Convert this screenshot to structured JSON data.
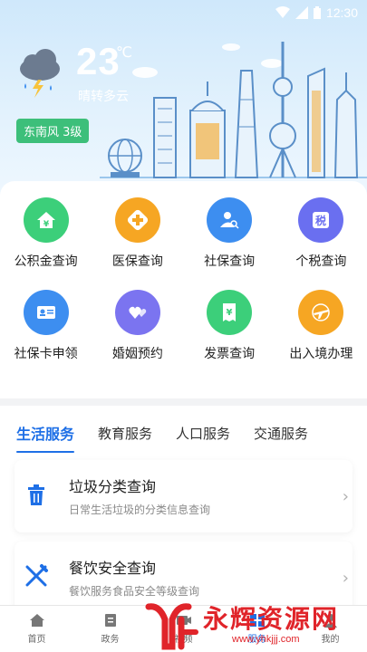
{
  "status_bar": {
    "time": "12:30"
  },
  "weather": {
    "temperature": "23",
    "unit": "℃",
    "description": "晴转多云",
    "wind": "东南风 3级",
    "icon": "cloud-rain-lightning-icon"
  },
  "services_grid": [
    {
      "label": "公积金查询",
      "icon": "home-yuan-icon",
      "color": "#3ccf7a"
    },
    {
      "label": "医保查询",
      "icon": "medical-cross-icon",
      "color": "#f6a623"
    },
    {
      "label": "社保查询",
      "icon": "person-search-icon",
      "color": "#3d8ef0"
    },
    {
      "label": "个税查询",
      "icon": "tax-icon",
      "color": "#6a6ff0"
    },
    {
      "label": "社保卡申领",
      "icon": "id-card-icon",
      "color": "#3d8ef0"
    },
    {
      "label": "婚姻预约",
      "icon": "hearts-icon",
      "color": "#7b74f0"
    },
    {
      "label": "发票查询",
      "icon": "invoice-icon",
      "color": "#3ccf7a"
    },
    {
      "label": "出入境办理",
      "icon": "airplane-icon",
      "color": "#f6a623"
    }
  ],
  "tabs": [
    {
      "label": "生活服务",
      "active": true
    },
    {
      "label": "教育服务",
      "active": false
    },
    {
      "label": "人口服务",
      "active": false
    },
    {
      "label": "交通服务",
      "active": false
    }
  ],
  "list": [
    {
      "title": "垃圾分类查询",
      "subtitle": "日常生活垃圾的分类信息查询",
      "icon": "trash-icon"
    },
    {
      "title": "餐饮安全查询",
      "subtitle": "餐饮服务食品安全等级查询",
      "icon": "fork-knife-icon"
    }
  ],
  "bottom_nav": [
    {
      "label": "首页",
      "icon": "home-icon",
      "active": false
    },
    {
      "label": "政务",
      "icon": "document-icon",
      "active": false
    },
    {
      "label": "视频",
      "icon": "video-icon",
      "active": false
    },
    {
      "label": "服务",
      "icon": "service-icon",
      "active": true
    },
    {
      "label": "我的",
      "icon": "user-icon",
      "active": false
    }
  ],
  "watermark": {
    "title": "永辉资源网",
    "url": "www.yhkjjj.com"
  },
  "colors": {
    "accent": "#1e6fe6",
    "wind_badge": "#3dbf7a",
    "watermark": "#e0242a"
  }
}
